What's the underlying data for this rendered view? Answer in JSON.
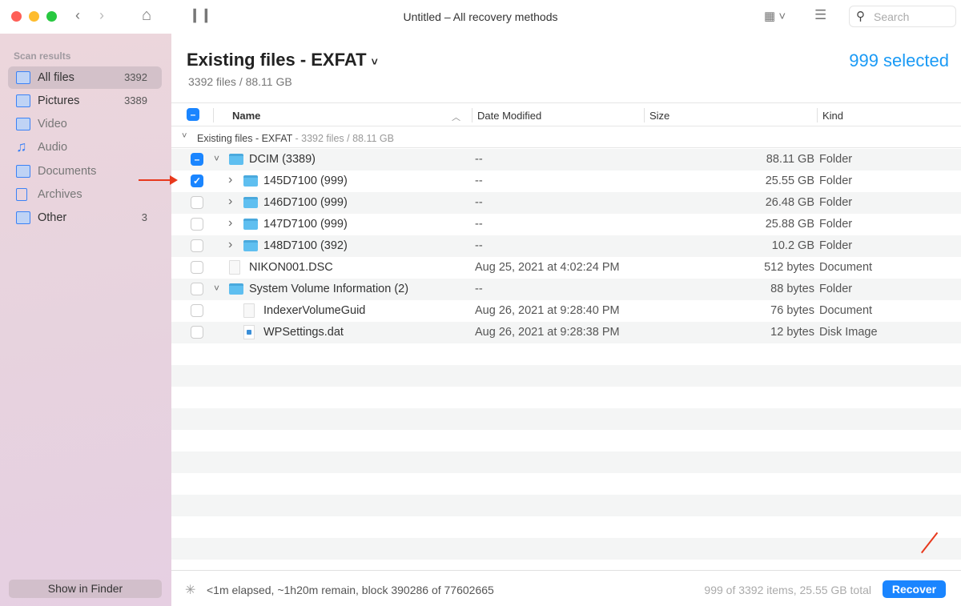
{
  "window": {
    "title": "Untitled – All recovery methods",
    "search_placeholder": "Search"
  },
  "sidebar": {
    "heading": "Scan results",
    "items": [
      {
        "label": "All files",
        "count": "3392",
        "active": true
      },
      {
        "label": "Pictures",
        "count": "3389"
      },
      {
        "label": "Video",
        "count": ""
      },
      {
        "label": "Audio",
        "count": ""
      },
      {
        "label": "Documents",
        "count": ""
      },
      {
        "label": "Archives",
        "count": ""
      },
      {
        "label": "Other",
        "count": "3"
      }
    ],
    "show_in_finder": "Show in Finder"
  },
  "header": {
    "title": "Existing files - EXFAT",
    "subtitle": "3392 files / 88.11 GB",
    "selected": "999 selected"
  },
  "columns": {
    "name": "Name",
    "date": "Date Modified",
    "size": "Size",
    "kind": "Kind"
  },
  "group": {
    "label": "Existing files - EXFAT",
    "detail": "- 3392 files / 88.11 GB"
  },
  "rows": [
    {
      "name": "DCIM (3389)",
      "date": "--",
      "size": "88.11 GB",
      "kind": "Folder",
      "level": 0,
      "expander": "open",
      "icon": "folder",
      "check": "mixed"
    },
    {
      "name": "145D7100 (999)",
      "date": "--",
      "size": "25.55 GB",
      "kind": "Folder",
      "level": 1,
      "expander": "closed",
      "icon": "folder",
      "check": "on"
    },
    {
      "name": "146D7100 (999)",
      "date": "--",
      "size": "26.48 GB",
      "kind": "Folder",
      "level": 1,
      "expander": "closed",
      "icon": "folder",
      "check": "off"
    },
    {
      "name": "147D7100 (999)",
      "date": "--",
      "size": "25.88 GB",
      "kind": "Folder",
      "level": 1,
      "expander": "closed",
      "icon": "folder",
      "check": "off"
    },
    {
      "name": "148D7100 (392)",
      "date": "--",
      "size": "10.2 GB",
      "kind": "Folder",
      "level": 1,
      "expander": "closed",
      "icon": "folder",
      "check": "off"
    },
    {
      "name": "NIKON001.DSC",
      "date": "Aug 25, 2021 at 4:02:24 PM",
      "size": "512 bytes",
      "kind": "Document",
      "level": 0,
      "expander": "none",
      "icon": "document",
      "check": "off"
    },
    {
      "name": "System Volume Information (2)",
      "date": "--",
      "size": "88 bytes",
      "kind": "Folder",
      "level": 0,
      "expander": "open",
      "icon": "folder",
      "check": "off"
    },
    {
      "name": "IndexerVolumeGuid",
      "date": "Aug 26, 2021 at 9:28:40 PM",
      "size": "76 bytes",
      "kind": "Document",
      "level": 1,
      "expander": "none",
      "icon": "document",
      "check": "off"
    },
    {
      "name": "WPSettings.dat",
      "date": "Aug 26, 2021 at 9:28:38 PM",
      "size": "12 bytes",
      "kind": "Disk Image",
      "level": 1,
      "expander": "none",
      "icon": "disk-image",
      "check": "off"
    }
  ],
  "footer": {
    "status": "<1m elapsed, ~1h20m remain, block 390286 of 77602665",
    "totals": "999 of 3392 items, 25.55 GB total",
    "recover": "Recover"
  },
  "colors": {
    "accent": "#1a85ff",
    "selected_text": "#1a9af5",
    "annotation_arrow": "#e8391d"
  }
}
